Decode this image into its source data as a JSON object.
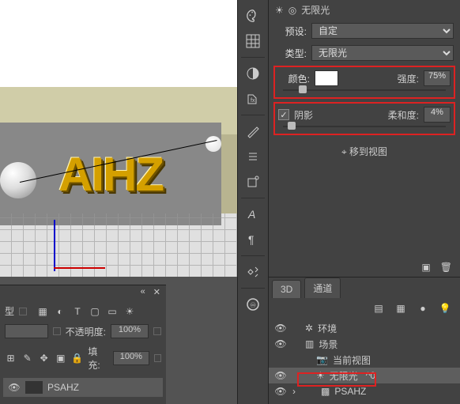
{
  "canvas": {
    "text3d": "AIHZ"
  },
  "topicons": {
    "none_light": "无限光"
  },
  "props": {
    "preset_label": "预设:",
    "preset_value": "自定",
    "type_label": "类型:",
    "type_value": "无限光",
    "color_label": "颜色:",
    "intensity_label": "强度:",
    "intensity_value": "75%",
    "shadow_label": "阴影",
    "softness_label": "柔和度:",
    "softness_value": "4%",
    "move_view": "移到视图"
  },
  "scene": {
    "tab_3d": "3D",
    "tab_channel": "通道",
    "items": {
      "env": "环境",
      "scene": "场景",
      "view": "当前视图",
      "light": "无限光",
      "light_suffix": "^0",
      "layer": "PSAHZ"
    }
  },
  "bottom": {
    "type_suffix": "型",
    "opacity_label": "不透明度:",
    "opacity_value": "100%",
    "fill_label": "填充:",
    "fill_value": "100%",
    "layer_name": "PSAHZ"
  },
  "tabs": {
    "collapse": "«",
    "close": "✕"
  }
}
